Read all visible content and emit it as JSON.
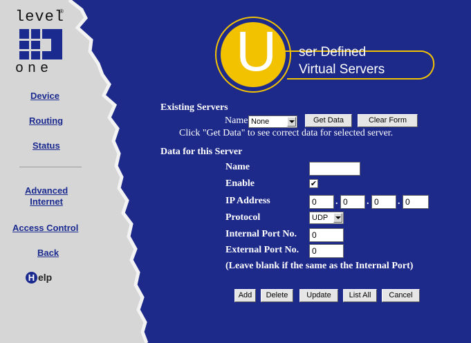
{
  "logo": {
    "top_text": "level",
    "reg": "®",
    "bottom_text": "one"
  },
  "nav": {
    "device": "Device",
    "routing": "Routing",
    "status": "Status",
    "advanced_line1": "Advanced",
    "advanced_line2": "Internet",
    "access_control": "Access Control",
    "back": "Back",
    "help_letter": "H",
    "help_rest": "elp"
  },
  "banner": {
    "big_letter": "U",
    "line1": "ser Defined",
    "line2": "Virtual Servers"
  },
  "existing": {
    "heading": "Existing Servers",
    "name_label": "Name",
    "name_select": "None",
    "get_data": "Get Data",
    "clear_form": "Clear Form",
    "hint": "Click \"Get Data\" to see correct data for selected server."
  },
  "server": {
    "heading": "Data for this Server",
    "name_label": "Name",
    "name_value": "",
    "enable_label": "Enable",
    "enable_checked": true,
    "ip_label": "IP Address",
    "ip": [
      "0",
      "0",
      "0",
      "0"
    ],
    "protocol_label": "Protocol",
    "protocol_value": "UDP",
    "internal_label": "Internal Port No.",
    "internal_value": "0",
    "external_label": "External Port No.",
    "external_value": "0",
    "note": "(Leave blank if the same as the Internal Port)"
  },
  "actions": {
    "add": "Add",
    "delete": "Delete",
    "update": "Update",
    "list_all": "List All",
    "cancel": "Cancel"
  },
  "colors": {
    "background": "#1e2a8a",
    "sidebar": "#d4d4d4",
    "accent": "#f2c200"
  }
}
